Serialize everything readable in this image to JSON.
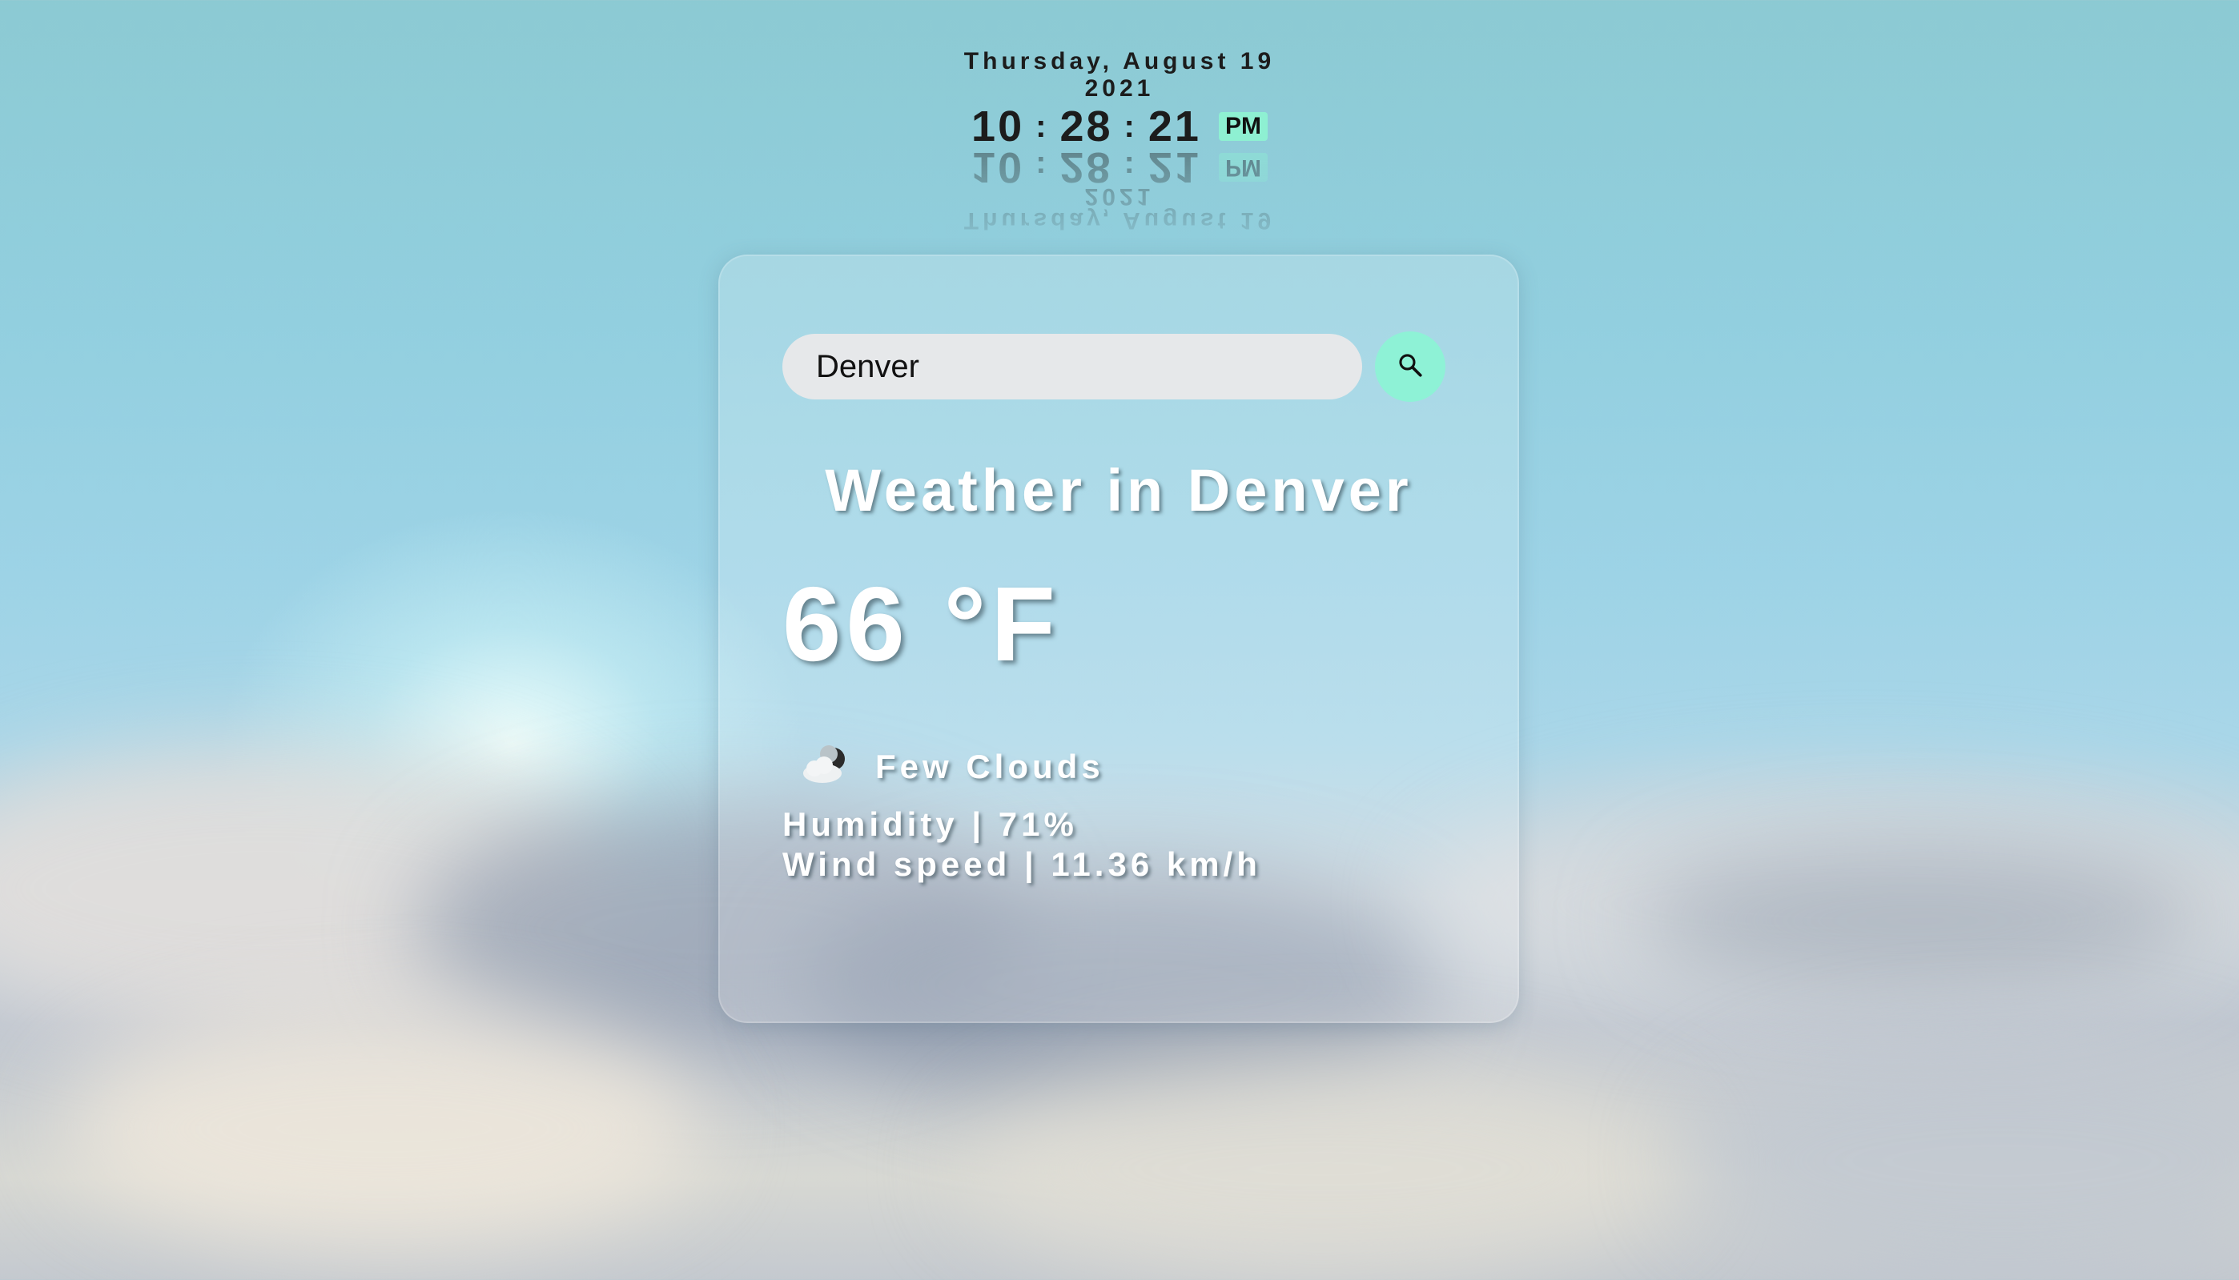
{
  "clock": {
    "date": "Thursday, August 19",
    "year": "2021",
    "hours": "10",
    "minutes": "28",
    "seconds": "21",
    "separator": ":",
    "ampm": "PM"
  },
  "search": {
    "value": "Denver"
  },
  "weather": {
    "headline": "Weather in Denver",
    "temperature": "66 °F",
    "description": "Few Clouds",
    "icon": "few-clouds-night-icon",
    "humidity": "Humidity | 71%",
    "wind": "Wind speed | 11.36 km/h"
  },
  "colors": {
    "accent": "#8ef2d6",
    "input_bg": "#e6e8ea",
    "text_light": "#ffffff",
    "text_dark": "#1c1c1c"
  }
}
